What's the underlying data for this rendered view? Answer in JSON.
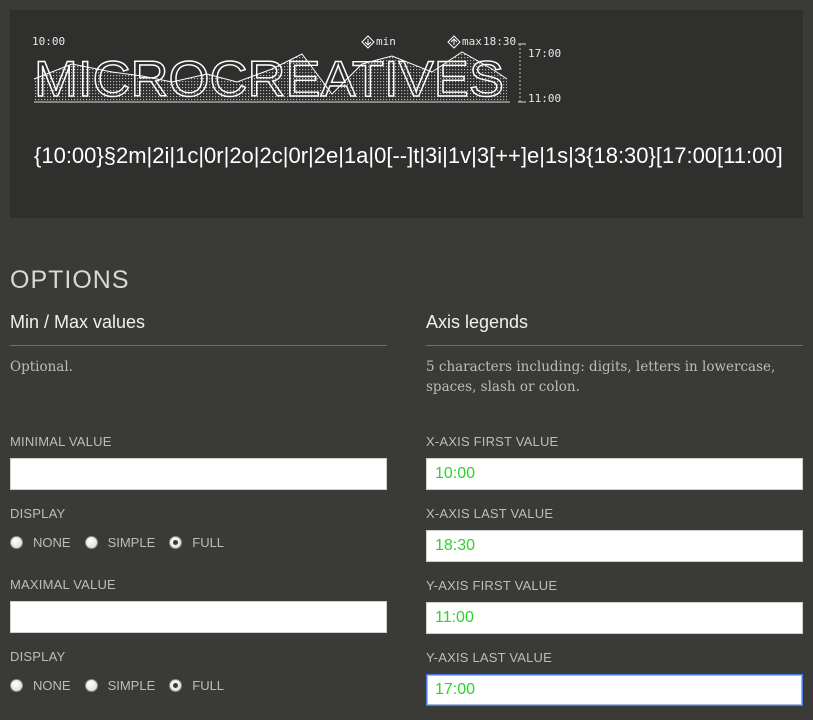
{
  "preview": {
    "banner_word": "MICROCREATIVES",
    "x_first": "10:00",
    "min_label": "min",
    "max_label": "max",
    "x_last": "18:30",
    "y_top": "17:00",
    "y_bottom": "11:00",
    "code": "{10:00}§2m|2i|1c|0r|2o|2c|0r|2e|1a|0[--]t|3i|1v|3[++]e|1s|3{18:30}[17:00[11:00]"
  },
  "options": {
    "title": "OPTIONS",
    "minmax": {
      "heading": "Min / Max values",
      "hint": "Optional.",
      "min_label": "MINIMAL VALUE",
      "min_value": "",
      "display_label": "DISPLAY",
      "max_label": "MAXIMAL VALUE",
      "max_value": "",
      "display_options": [
        "NONE",
        "SIMPLE",
        "FULL"
      ],
      "min_display_selected": "FULL",
      "max_display_selected": "FULL"
    },
    "axis": {
      "heading": "Axis legends",
      "hint": "5 characters including: digits, letters in lowercase, spaces, slash or colon.",
      "x_first_label": "X-AXIS FIRST VALUE",
      "x_first_value": "10:00",
      "x_last_label": "X-AXIS LAST VALUE",
      "x_last_value": "18:30",
      "y_first_label": "Y-AXIS FIRST VALUE",
      "y_first_value": "11:00",
      "y_last_label": "Y-AXIS LAST VALUE",
      "y_last_value": "17:00"
    }
  },
  "colors": {
    "page_bg": "#3a3a37",
    "preview_bg": "#2f2f2d",
    "input_text": "#2bd32b",
    "focus_border": "#4b7be0"
  },
  "icons": {
    "min_marker": "down-arrow-diamond-icon",
    "max_marker": "up-arrow-diamond-icon"
  }
}
